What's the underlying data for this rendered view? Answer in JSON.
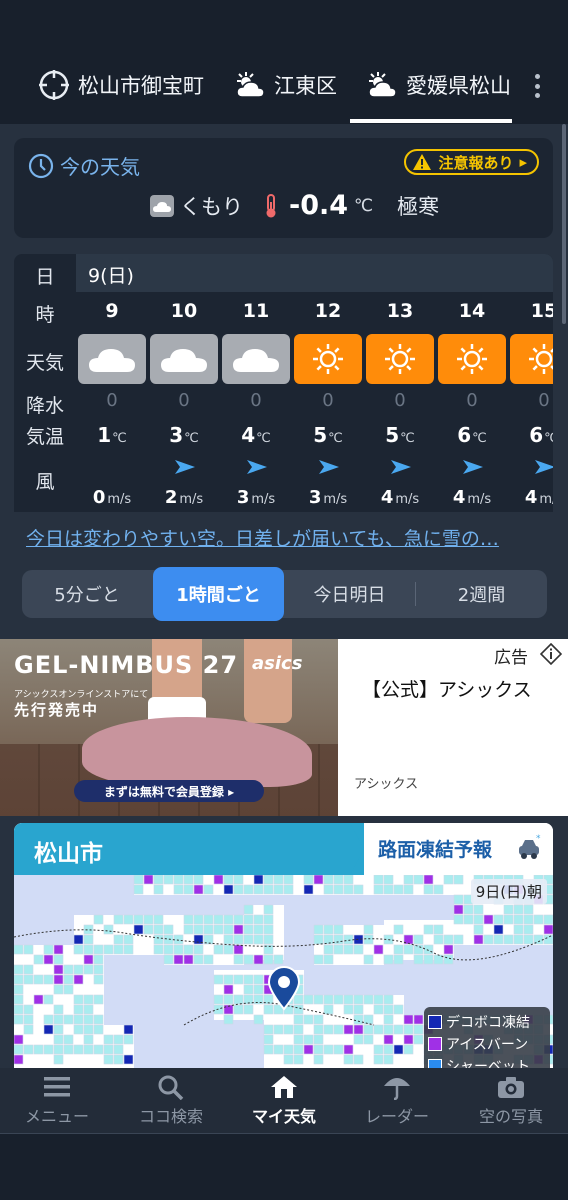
{
  "locations": [
    {
      "label": "松山市御宝町",
      "icon": "target-icon"
    },
    {
      "label": "江東区",
      "icon": "sun-behind-cloud-icon"
    },
    {
      "label": "愛媛県松山市",
      "icon": "sun-behind-cloud-icon",
      "active": true
    }
  ],
  "current": {
    "title": "今の天気",
    "alert": "注意報あり",
    "condition": "くもり",
    "temperature": "-0.4",
    "unit": "℃",
    "feel": "極寒"
  },
  "hourly": {
    "row_labels": {
      "date": "日",
      "hour": "時",
      "weather": "天気",
      "precip": "降水",
      "temp": "気温",
      "wind": "風"
    },
    "date": "9(日)",
    "temp_unit": "℃",
    "wind_unit": "m/s",
    "hours": [
      {
        "hour": "9",
        "weather": "cloudy",
        "precip": "0",
        "temp": "1",
        "wind": "0",
        "arrow": false
      },
      {
        "hour": "10",
        "weather": "cloudy",
        "precip": "0",
        "temp": "3",
        "wind": "2",
        "arrow": true
      },
      {
        "hour": "11",
        "weather": "cloudy",
        "precip": "0",
        "temp": "4",
        "wind": "3",
        "arrow": true
      },
      {
        "hour": "12",
        "weather": "sunny",
        "precip": "0",
        "temp": "5",
        "wind": "3",
        "arrow": true
      },
      {
        "hour": "13",
        "weather": "sunny",
        "precip": "0",
        "temp": "5",
        "wind": "4",
        "arrow": true
      },
      {
        "hour": "14",
        "weather": "sunny",
        "precip": "0",
        "temp": "6",
        "wind": "4",
        "arrow": true
      },
      {
        "hour": "15",
        "weather": "sunny",
        "precip": "0",
        "temp": "6",
        "wind": "4",
        "arrow": true
      }
    ]
  },
  "forecast_link": "今日は変わりやすい空。日差しが届いても、急に雪の…",
  "intervals": [
    {
      "label": "5分ごと"
    },
    {
      "label": "1時間ごと",
      "active": true
    },
    {
      "label": "今日明日"
    },
    {
      "label": "2週間"
    }
  ],
  "ad": {
    "headline": "GEL-NIMBUS 27",
    "brand": "asics",
    "small_text": "アシックスオンラインストアにて",
    "subline": "先行発売中",
    "cta": "まずは無料で会員登録 ▸",
    "label": "広告",
    "title": "【公式】アシックス",
    "advertiser": "アシックス"
  },
  "road_map": {
    "city": "松山市",
    "title": "路面凍結予報",
    "date": "9日(日)朝",
    "legend": [
      {
        "label": "デコボコ凍結",
        "color": "#1428b4"
      },
      {
        "label": "アイスバーン",
        "color": "#a030e6"
      },
      {
        "label": "シャーベット",
        "color": "#2a8cf0"
      }
    ]
  },
  "nav": [
    {
      "label": "メニュー",
      "icon": "menu-icon"
    },
    {
      "label": "ココ検索",
      "icon": "search-icon"
    },
    {
      "label": "マイ天気",
      "icon": "home-icon",
      "active": true
    },
    {
      "label": "レーダー",
      "icon": "umbrella-icon"
    },
    {
      "label": "空の写真",
      "icon": "camera-icon"
    }
  ],
  "colors": {
    "accent": "#3d8df0",
    "sunny": "#ff8c0a",
    "cloudy": "#a8acb2",
    "alert": "#f5c400",
    "map_header": "#29a5cf"
  }
}
